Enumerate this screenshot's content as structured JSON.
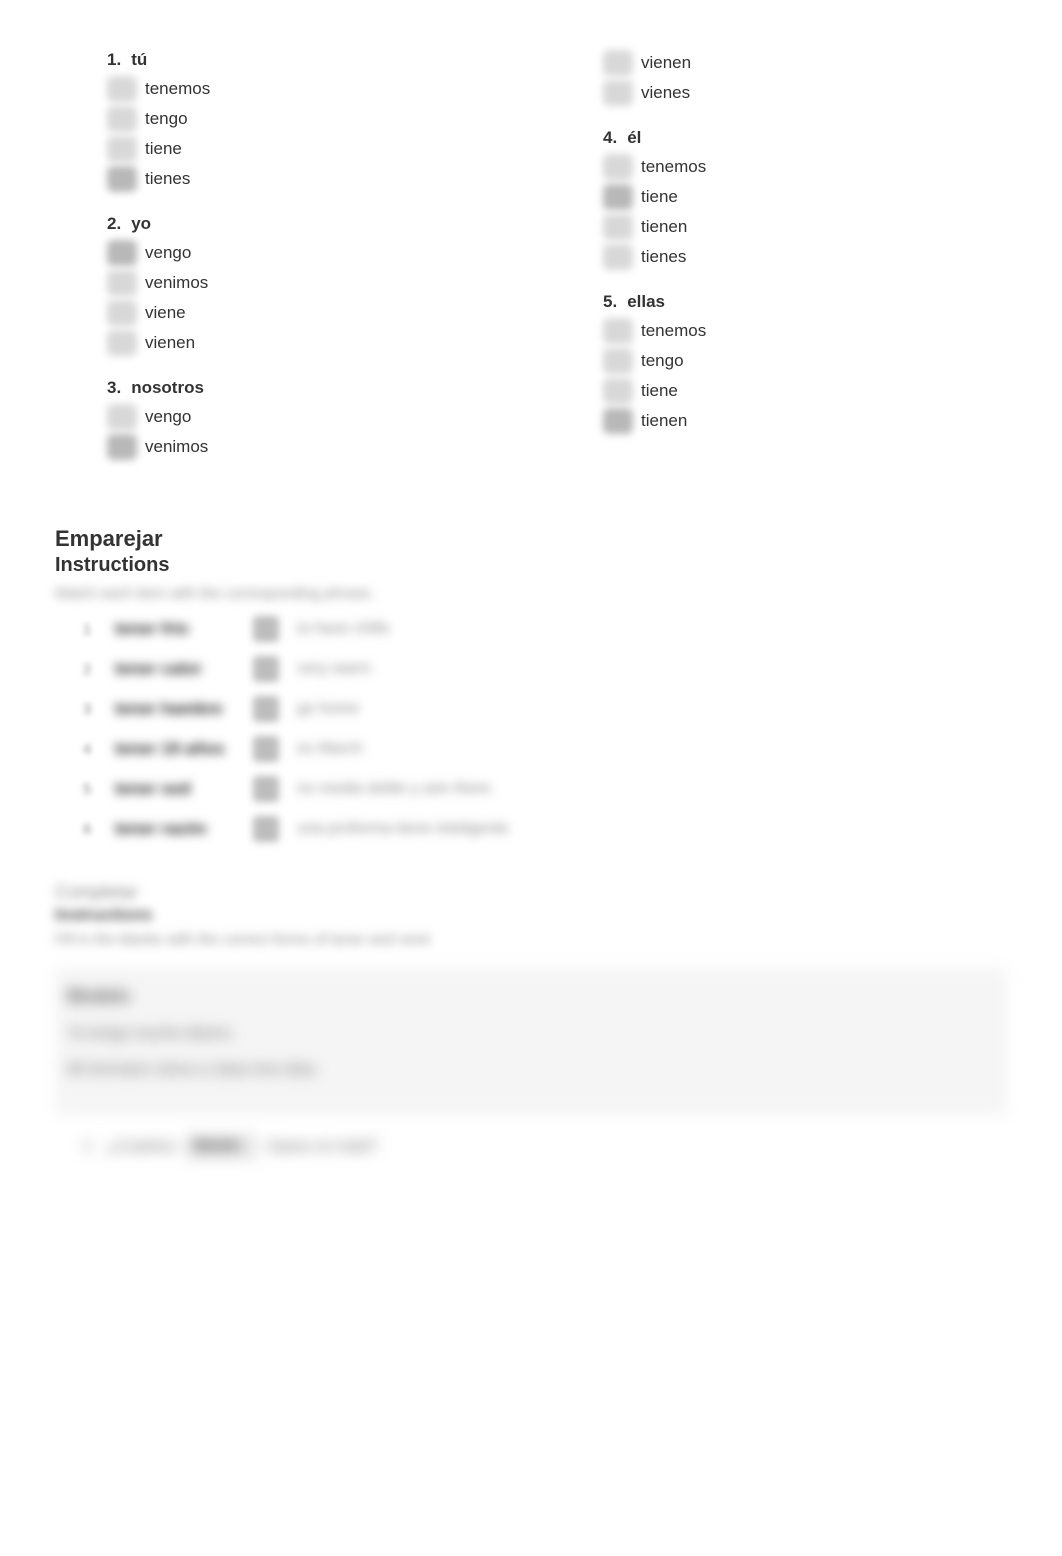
{
  "quiz": {
    "questions": [
      {
        "num": "1.",
        "prompt": "tú",
        "options": [
          "tenemos",
          "tengo",
          "tiene",
          "tienes"
        ],
        "selected": 3
      },
      {
        "num": "2.",
        "prompt": "yo",
        "options": [
          "vengo",
          "venimos",
          "viene",
          "vienen"
        ],
        "selected": 0
      },
      {
        "num": "3.",
        "prompt": "nosotros",
        "options": [
          "vengo",
          "venimos",
          "vienen",
          "vienes"
        ],
        "selected": 1
      },
      {
        "num": "4.",
        "prompt": "él",
        "options": [
          "tenemos",
          "tiene",
          "tienen",
          "tienes"
        ],
        "selected": 1
      },
      {
        "num": "5.",
        "prompt": "ellas",
        "options": [
          "tenemos",
          "tengo",
          "tiene",
          "tienen"
        ],
        "selected": 3
      }
    ]
  },
  "emparejar": {
    "title": "Emparejar",
    "subtitle": "Instructions",
    "instructions_blur": "Match each item with the corresponding phrase.",
    "rows": [
      {
        "n": "1",
        "left": "tener frío",
        "right": "to have chills"
      },
      {
        "n": "2",
        "left": "tener calor",
        "right": "very warm"
      },
      {
        "n": "3",
        "left": "tener hambre",
        "right": "go home"
      },
      {
        "n": "4",
        "left": "tener 19 años",
        "right": "es March"
      },
      {
        "n": "5",
        "left": "tener sed",
        "right": "no media doble y aún there"
      },
      {
        "n": "6",
        "left": "tener razón",
        "right": "una proforma tiene inteligente"
      }
    ]
  },
  "completar": {
    "title": "Completar",
    "subtitle": "Instructions",
    "instructions": "Fill in the blanks with the correct forms of     tener    and    venir",
    "model_label": "Modelo",
    "model_line1": "Yo tengo   mucho dinero.",
    "model_line2": "Mi hermano viene a clase tres días.",
    "item": {
      "n": "1",
      "before": "¿Cuántos",
      "value": "tienen",
      "after": "clases en total?"
    }
  }
}
